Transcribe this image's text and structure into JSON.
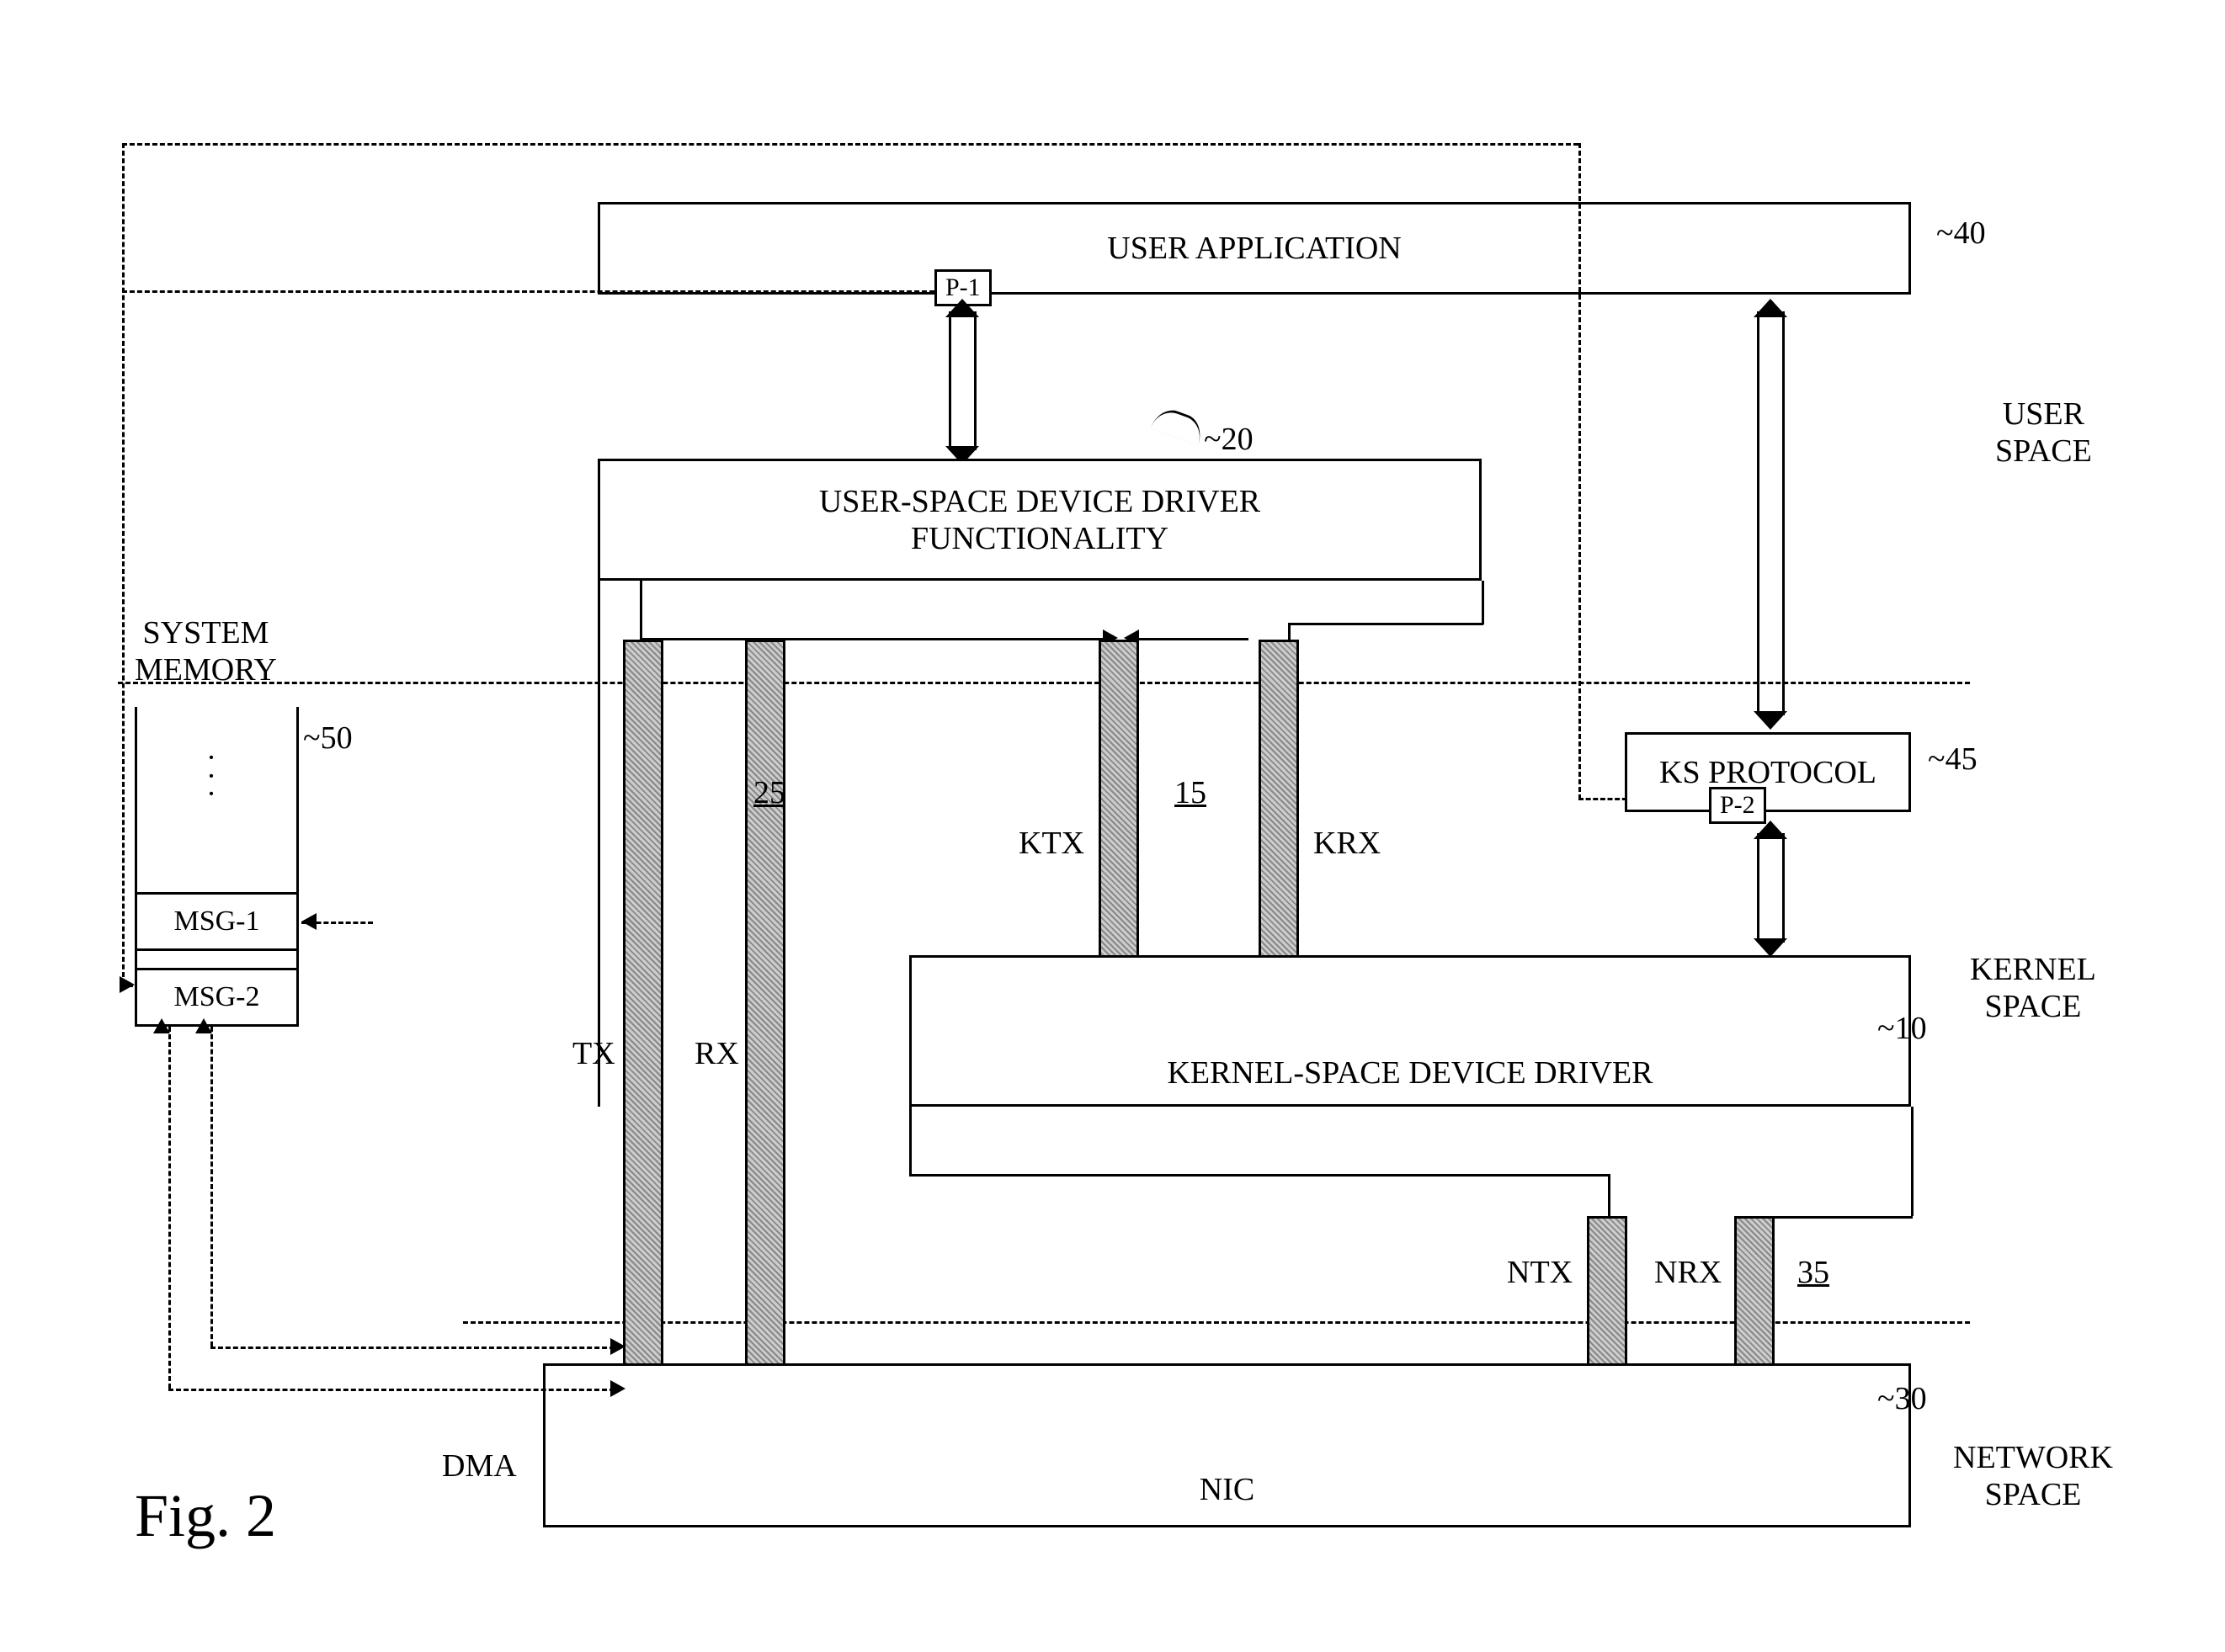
{
  "figure_label": "Fig. 2",
  "regions": {
    "user_space": "USER\nSPACE",
    "kernel_space": "KERNEL\nSPACE",
    "network_space": "NETWORK\nSPACE"
  },
  "boxes": {
    "user_app": {
      "label": "USER APPLICATION",
      "ref": "40",
      "port": "P-1"
    },
    "usd_driver": {
      "label": "USER-SPACE DEVICE DRIVER\nFUNCTIONALITY",
      "ref": "20"
    },
    "ksd_driver": {
      "label": "KERNEL-SPACE DEVICE DRIVER",
      "ref": "10"
    },
    "ks_protocol": {
      "label": "KS PROTOCOL",
      "ref": "45",
      "port": "P-2"
    },
    "nic": {
      "label": "NIC",
      "ref": "30"
    },
    "sys_mem": {
      "label": "SYSTEM\nMEMORY",
      "ref": "50"
    }
  },
  "queues": {
    "tx": {
      "label": "TX",
      "ref": "25"
    },
    "rx": {
      "label": "RX"
    },
    "ktx": {
      "label": "KTX",
      "ref": "15"
    },
    "krx": {
      "label": "KRX"
    },
    "ntx": {
      "label": "NTX",
      "ref": "35"
    },
    "nrx": {
      "label": "NRX"
    }
  },
  "memory": {
    "msg1": "MSG-1",
    "msg2": "MSG-2"
  },
  "misc": {
    "dma": "DMA"
  }
}
